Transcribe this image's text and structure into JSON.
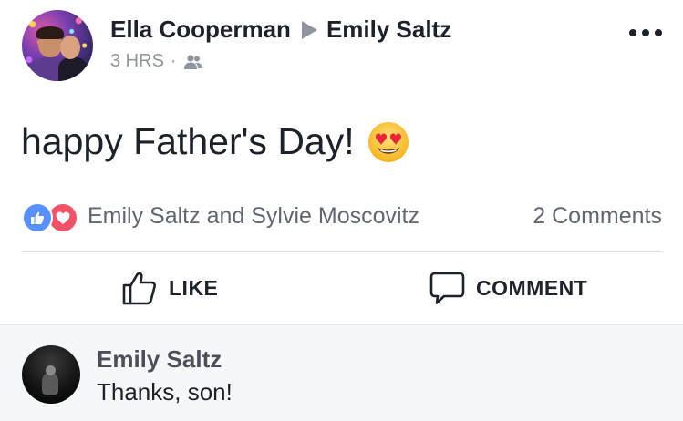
{
  "post": {
    "author": "Ella Cooperman",
    "target": "Emily Saltz",
    "time": "3 HRS",
    "separator": "·",
    "audience_icon": "friends-icon",
    "more_icon": "more-options-icon",
    "message": "happy Father's Day!",
    "emoji": "heart-eyes-emoji"
  },
  "reactions": {
    "icons": [
      "like-reaction-icon",
      "love-reaction-icon"
    ],
    "names": "Emily Saltz and Sylvie Moscovitz",
    "comments_count": "2 Comments"
  },
  "actions": {
    "like_label": "LIKE",
    "comment_label": "COMMENT"
  },
  "comments": [
    {
      "author": "Emily Saltz",
      "text": "Thanks, son!"
    }
  ],
  "colors": {
    "text_primary": "#1d2129",
    "text_secondary": "#90949c",
    "like_blue": "#5890ff",
    "love_red": "#f25268",
    "comment_bg": "#f6f7f9"
  }
}
